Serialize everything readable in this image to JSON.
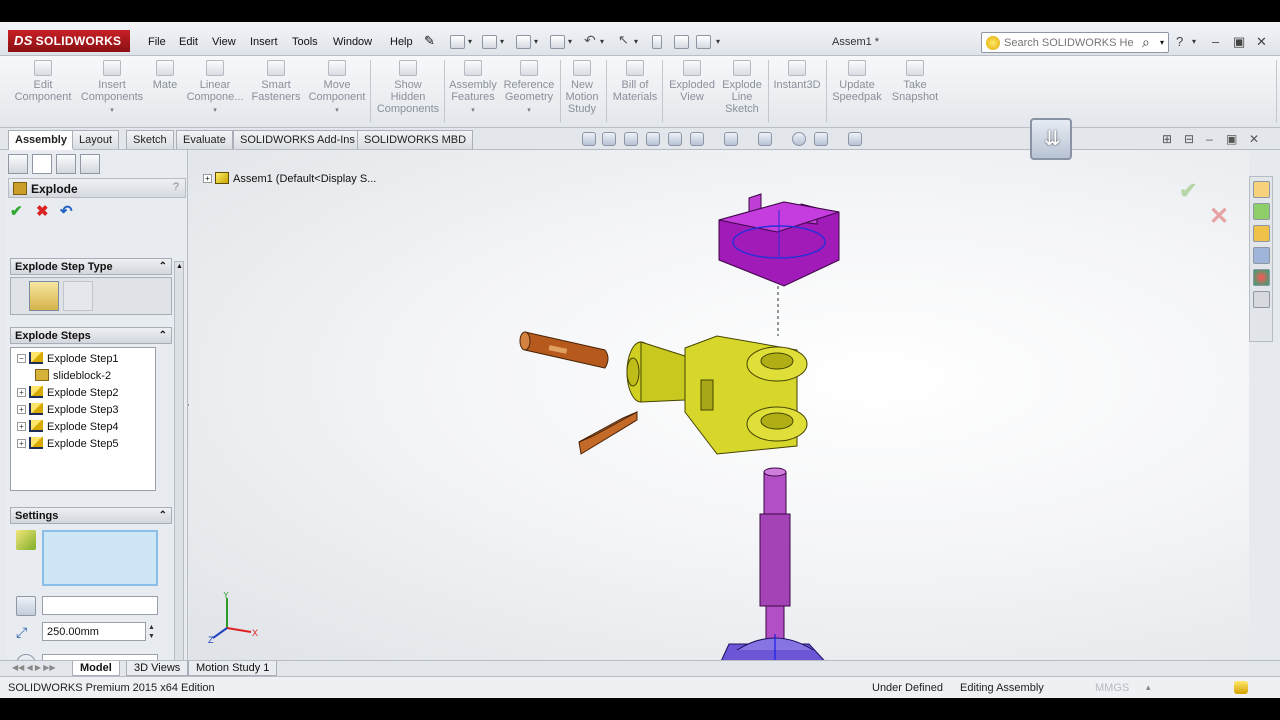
{
  "app": {
    "logo_text": "SOLIDWORKS",
    "logo_prefix": "DS",
    "document_title": "Assem1 *",
    "search_placeholder": "Search SOLIDWORKS Help"
  },
  "menu": [
    "File",
    "Edit",
    "View",
    "Insert",
    "Tools",
    "Window",
    "Help"
  ],
  "commands": [
    {
      "label": "Edit\nComponent",
      "icon": "edit-component-icon"
    },
    {
      "label": "Insert\nComponents",
      "icon": "insert-components-icon"
    },
    {
      "label": "Mate",
      "icon": "mate-icon"
    },
    {
      "label": "Linear\nCompone...",
      "icon": "linear-pattern-icon"
    },
    {
      "label": "Smart\nFasteners",
      "icon": "smart-fasteners-icon"
    },
    {
      "label": "Move\nComponent",
      "icon": "move-component-icon"
    },
    {
      "label": "Show\nHidden\nComponents",
      "icon": "show-hidden-icon"
    },
    {
      "label": "Assembly\nFeatures",
      "icon": "assembly-features-icon"
    },
    {
      "label": "Reference\nGeometry",
      "icon": "reference-geometry-icon"
    },
    {
      "label": "New\nMotion\nStudy",
      "icon": "motion-study-icon"
    },
    {
      "label": "Bill of\nMaterials",
      "icon": "bom-icon"
    },
    {
      "label": "Exploded\nView",
      "icon": "exploded-view-icon"
    },
    {
      "label": "Explode\nLine\nSketch",
      "icon": "explode-line-sketch-icon"
    },
    {
      "label": "Instant3D",
      "icon": "instant3d-icon"
    },
    {
      "label": "Update\nSpeedpak",
      "icon": "speedpak-icon"
    },
    {
      "label": "Take\nSnapshot",
      "icon": "snapshot-icon"
    }
  ],
  "tabs": [
    "Assembly",
    "Layout",
    "Sketch",
    "Evaluate",
    "SOLIDWORKS Add-Ins",
    "SOLIDWORKS MBD"
  ],
  "property_manager": {
    "title": "Explode",
    "help": "?",
    "ok": "✔",
    "cancel": "✖",
    "undo": "↶",
    "step_type_header": "Explode Step Type",
    "steps_header": "Explode Steps",
    "steps": [
      {
        "label": "Explode Step1",
        "expanded": true,
        "children": [
          "slideblock-2"
        ]
      },
      {
        "label": "Explode Step2"
      },
      {
        "label": "Explode Step3"
      },
      {
        "label": "Explode Step4"
      },
      {
        "label": "Explode Step5"
      }
    ],
    "settings_header": "Settings",
    "distance": "250.00mm"
  },
  "feature_tree_root": "Assem1  (Default<Display S...",
  "bottom_tabs": [
    "Model",
    "3D Views",
    "Motion Study 1"
  ],
  "status": {
    "edition": "SOLIDWORKS Premium 2015 x64 Edition",
    "definition": "Under Defined",
    "mode": "Editing Assembly",
    "units": "MMGS"
  },
  "triad": {
    "x": "X",
    "y": "Y",
    "z": "Z"
  },
  "colors": {
    "clevis": "#d7d62a",
    "slideblock": "#a81fbf",
    "pin": "#b65a1c",
    "shaft": "#b24fc4",
    "base": "#6d56d6"
  }
}
